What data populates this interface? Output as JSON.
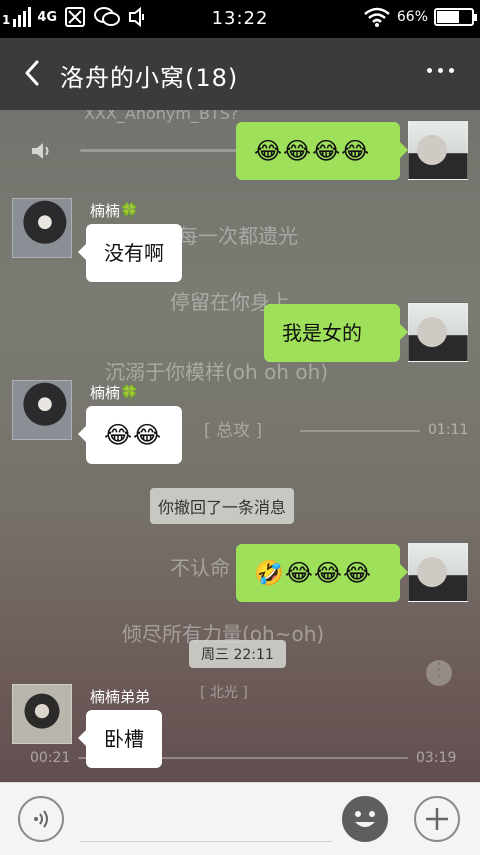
{
  "status_bar": {
    "signal_label": "1",
    "network": "4G",
    "time": "13:22",
    "battery_percent": "66%",
    "battery_level": 0.66,
    "icons": [
      "signal-icon",
      "no-sim-icon",
      "wechat-icon",
      "vibrate-icon",
      "wifi-icon",
      "battery-icon"
    ]
  },
  "header": {
    "title": "洛舟的小窝(18)",
    "back_icon": "chevron-left-icon",
    "more_icon": "more-dots-icon"
  },
  "background_player": {
    "lyrics": [
      "XXX_Anonym_BTS?",
      "每一次都遗光",
      "停留在你身上",
      "沉溺于你模样(oh oh oh)",
      "[ 总攻 ]",
      "不认命",
      "倾尽所有力量(oh~oh)",
      "[ 北光 ]"
    ],
    "time_marker": "01:11",
    "elapsed": "00:21",
    "duration": "03:19",
    "speaker_icon": "speaker-icon"
  },
  "messages": [
    {
      "side": "right",
      "sender": "",
      "content": "😂😂😂😂",
      "type": "emoji"
    },
    {
      "side": "left",
      "sender": "楠楠🍀",
      "content": "没有啊",
      "type": "text"
    },
    {
      "side": "right",
      "sender": "",
      "content": "我是女的",
      "type": "text"
    },
    {
      "side": "left",
      "sender": "楠楠🍀",
      "content": "😂😂",
      "type": "emoji"
    },
    {
      "side": "system",
      "content": "你撤回了一条消息"
    },
    {
      "side": "right",
      "sender": "",
      "content": "🤣😂😂😂",
      "type": "emoji"
    },
    {
      "side": "time",
      "content": "周三 22:11"
    },
    {
      "side": "left",
      "sender": "楠楠弟弟",
      "content": "卧槽",
      "type": "text"
    }
  ],
  "input_bar": {
    "placeholder": "",
    "value": "",
    "voice_icon": "voice-icon",
    "emoji_icon": "emoji-icon",
    "plus_icon": "plus-icon"
  },
  "colors": {
    "bubble_outgoing": "#9ee05a",
    "bubble_incoming": "#ffffff",
    "title_bar": "#3b3b3b",
    "status_bar": "#000000"
  }
}
